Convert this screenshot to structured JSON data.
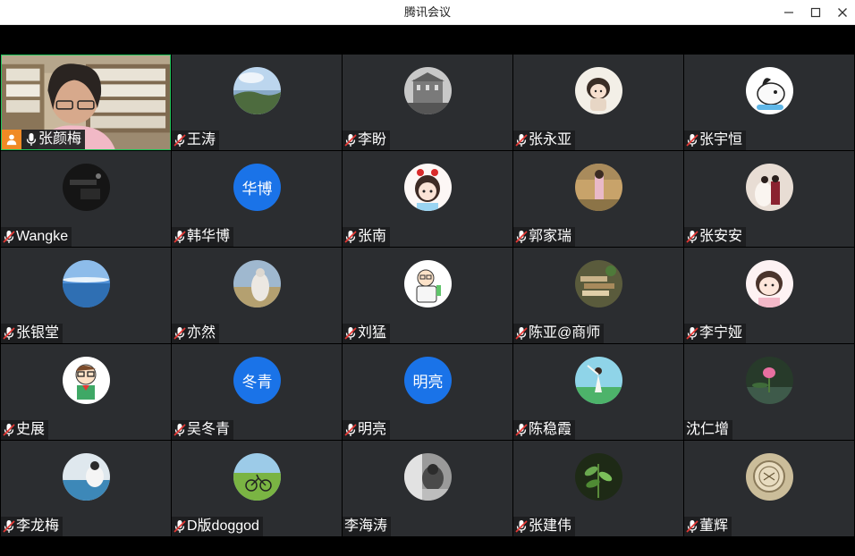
{
  "window": {
    "title": "腾讯会议"
  },
  "participants": [
    {
      "name": "张颜梅",
      "mic": "on",
      "host": true,
      "video": true
    },
    {
      "name": "王涛",
      "mic": "muted",
      "avatar": "landscape"
    },
    {
      "name": "李盼",
      "mic": "muted",
      "avatar": "building"
    },
    {
      "name": "张永亚",
      "mic": "muted",
      "avatar": "cartoon-girl"
    },
    {
      "name": "张宇恒",
      "mic": "muted",
      "avatar": "cartoon-dog"
    },
    {
      "name": "Wangke",
      "mic": "muted",
      "avatar": "dark-room"
    },
    {
      "name": "韩华博",
      "mic": "muted",
      "avatar_text": "华博"
    },
    {
      "name": "张南",
      "mic": "muted",
      "avatar": "anime-girl"
    },
    {
      "name": "郭家瑞",
      "mic": "muted",
      "avatar": "field-photo"
    },
    {
      "name": "张安安",
      "mic": "muted",
      "avatar": "wedding"
    },
    {
      "name": "张银堂",
      "mic": "muted",
      "avatar": "sky"
    },
    {
      "name": "亦然",
      "mic": "muted",
      "avatar": "statue"
    },
    {
      "name": "刘猛",
      "mic": "muted",
      "avatar": "scientist"
    },
    {
      "name": "陈亚@商师",
      "mic": "muted",
      "avatar": "books"
    },
    {
      "name": "李宁娅",
      "mic": "muted",
      "avatar": "cartoon-girl-2"
    },
    {
      "name": "史展",
      "mic": "muted",
      "avatar": "cartoon-boy"
    },
    {
      "name": "吴冬青",
      "mic": "muted",
      "avatar_text": "冬青"
    },
    {
      "name": "明亮",
      "mic": "muted",
      "avatar_text": "明亮"
    },
    {
      "name": "陈稳霞",
      "mic": "muted",
      "avatar": "dancer"
    },
    {
      "name": "沈仁增",
      "mic": "none",
      "avatar": "lotus"
    },
    {
      "name": "李龙梅",
      "mic": "muted",
      "avatar": "sea"
    },
    {
      "name": "D版doggod",
      "mic": "muted",
      "avatar": "bicycle"
    },
    {
      "name": "李海涛",
      "mic": "none",
      "avatar": "bw-photo"
    },
    {
      "name": "张建伟",
      "mic": "muted",
      "avatar": "plant"
    },
    {
      "name": "董辉",
      "mic": "muted",
      "avatar": "coin"
    }
  ]
}
